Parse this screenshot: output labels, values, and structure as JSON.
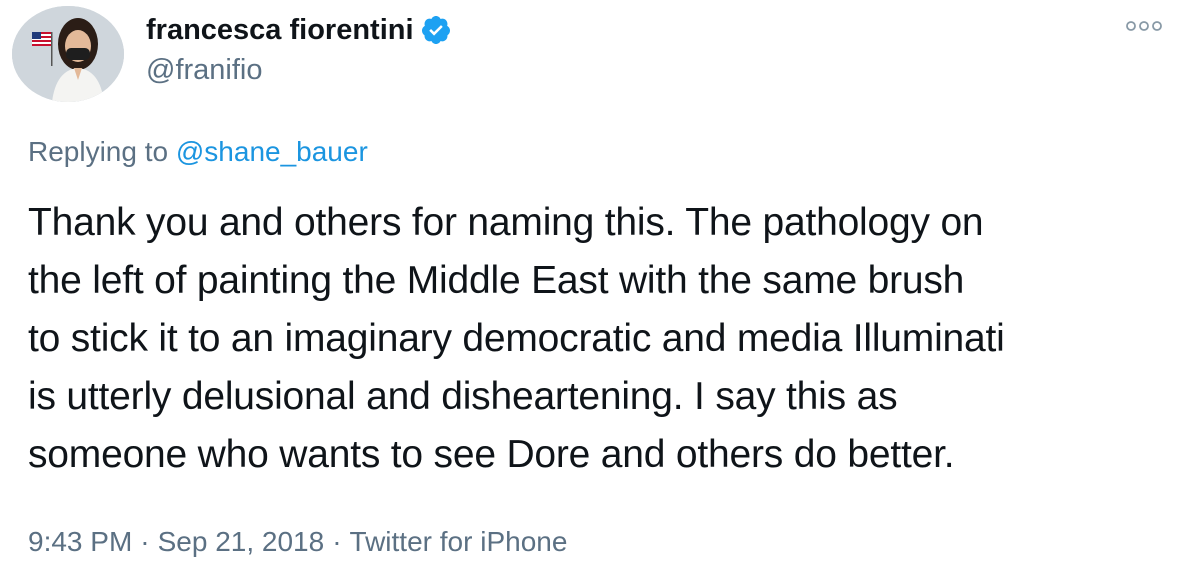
{
  "author": {
    "name": "francesca fiorentini",
    "handle": "@franifio",
    "verified": true
  },
  "reply": {
    "prefix": "Replying to ",
    "mention": "@shane_bauer"
  },
  "tweet": {
    "lines": [
      "Thank you and others for naming this. The pathology on",
      "the left of painting the Middle East with the same brush",
      "to stick it to an imaginary democratic and media Illuminati",
      "is utterly delusional and disheartening. I say this as",
      "someone who wants to see Dore and others do better."
    ]
  },
  "meta": {
    "time": "9:43 PM",
    "separator": "·",
    "date": "Sep 21, 2018",
    "source": "Twitter for iPhone"
  },
  "colors": {
    "link": "#1b95e0",
    "verified": "#1da1f2",
    "secondary_text": "#5b7083",
    "primary_text": "#0f1419"
  },
  "icons": {
    "verified": "verified-badge-icon",
    "more": "more-options-icon"
  }
}
